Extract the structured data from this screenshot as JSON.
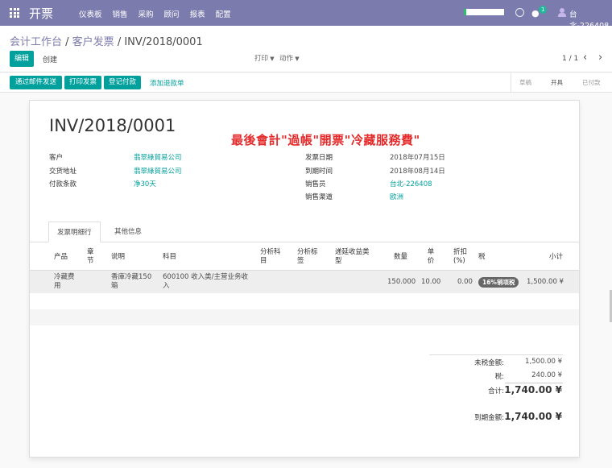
{
  "navbar": {
    "app_title": "开票",
    "menu": [
      "仪表板",
      "销售",
      "采购",
      "顾问",
      "报表",
      "配置"
    ],
    "chat_badge": "1",
    "user": "台北-226408"
  },
  "breadcrumb": {
    "part1": "会计工作台",
    "part2": "客户发票",
    "current": "INV/2018/0001"
  },
  "toolbar": {
    "edit": "编辑",
    "create": "创建",
    "print": "打印",
    "action": "动作",
    "pager": "1 / 1"
  },
  "status_buttons": {
    "email": "通过邮件发送",
    "print": "打印发票",
    "register": "登记付款",
    "credit_note": "添加退款单"
  },
  "stages": [
    "草稿",
    "开具",
    "已付款"
  ],
  "invoice": {
    "number": "INV/2018/0001",
    "note": "最後會計\"過帳\"開票\"冷藏服務費\"",
    "customer_label": "客户",
    "customer": "翡翠綠貿易公司",
    "delivery_label": "交货地址",
    "delivery": "翡翠綠貿易公司",
    "terms_label": "付款条款",
    "terms": "净30天",
    "date_label": "发票日期",
    "date": "2018年07月15日",
    "due_label": "到期时间",
    "due": "2018年08月14日",
    "salesperson_label": "销售员",
    "salesperson": "台北-226408",
    "channel_label": "销售渠道",
    "channel": "欧洲"
  },
  "tabs": {
    "lines": "发票明细行",
    "other": "其他信息"
  },
  "table": {
    "headers": {
      "product": "产品",
      "section": "章节",
      "desc": "说明",
      "account": "科目",
      "analytic_account": "分析科目",
      "analytic_tag": "分析标签",
      "deferred": "递延收益类型",
      "qty": "数量",
      "price": "单价",
      "discount": "折扣(%)",
      "tax": "税",
      "subtotal": "小计"
    },
    "row": {
      "product": "冷藏费用",
      "desc": "香庫冷藏150箱",
      "account": "600100 收入类/主营业务收入",
      "qty": "150.000",
      "price": "10.00",
      "discount": "0.00",
      "tax": "16%销项税",
      "subtotal": "1,500.00 ¥"
    }
  },
  "totals": {
    "untaxed_label": "未税金额:",
    "untaxed": "1,500.00 ¥",
    "tax_label": "税:",
    "tax": "240.00 ¥",
    "total_label": "合计:",
    "total": "1,740.00 ¥",
    "due_label": "到期金额:",
    "due": "1,740.00 ¥"
  },
  "colors": {
    "navbar": "#7c7bad",
    "primary": "#00a09d",
    "note": "#e42b2b"
  }
}
